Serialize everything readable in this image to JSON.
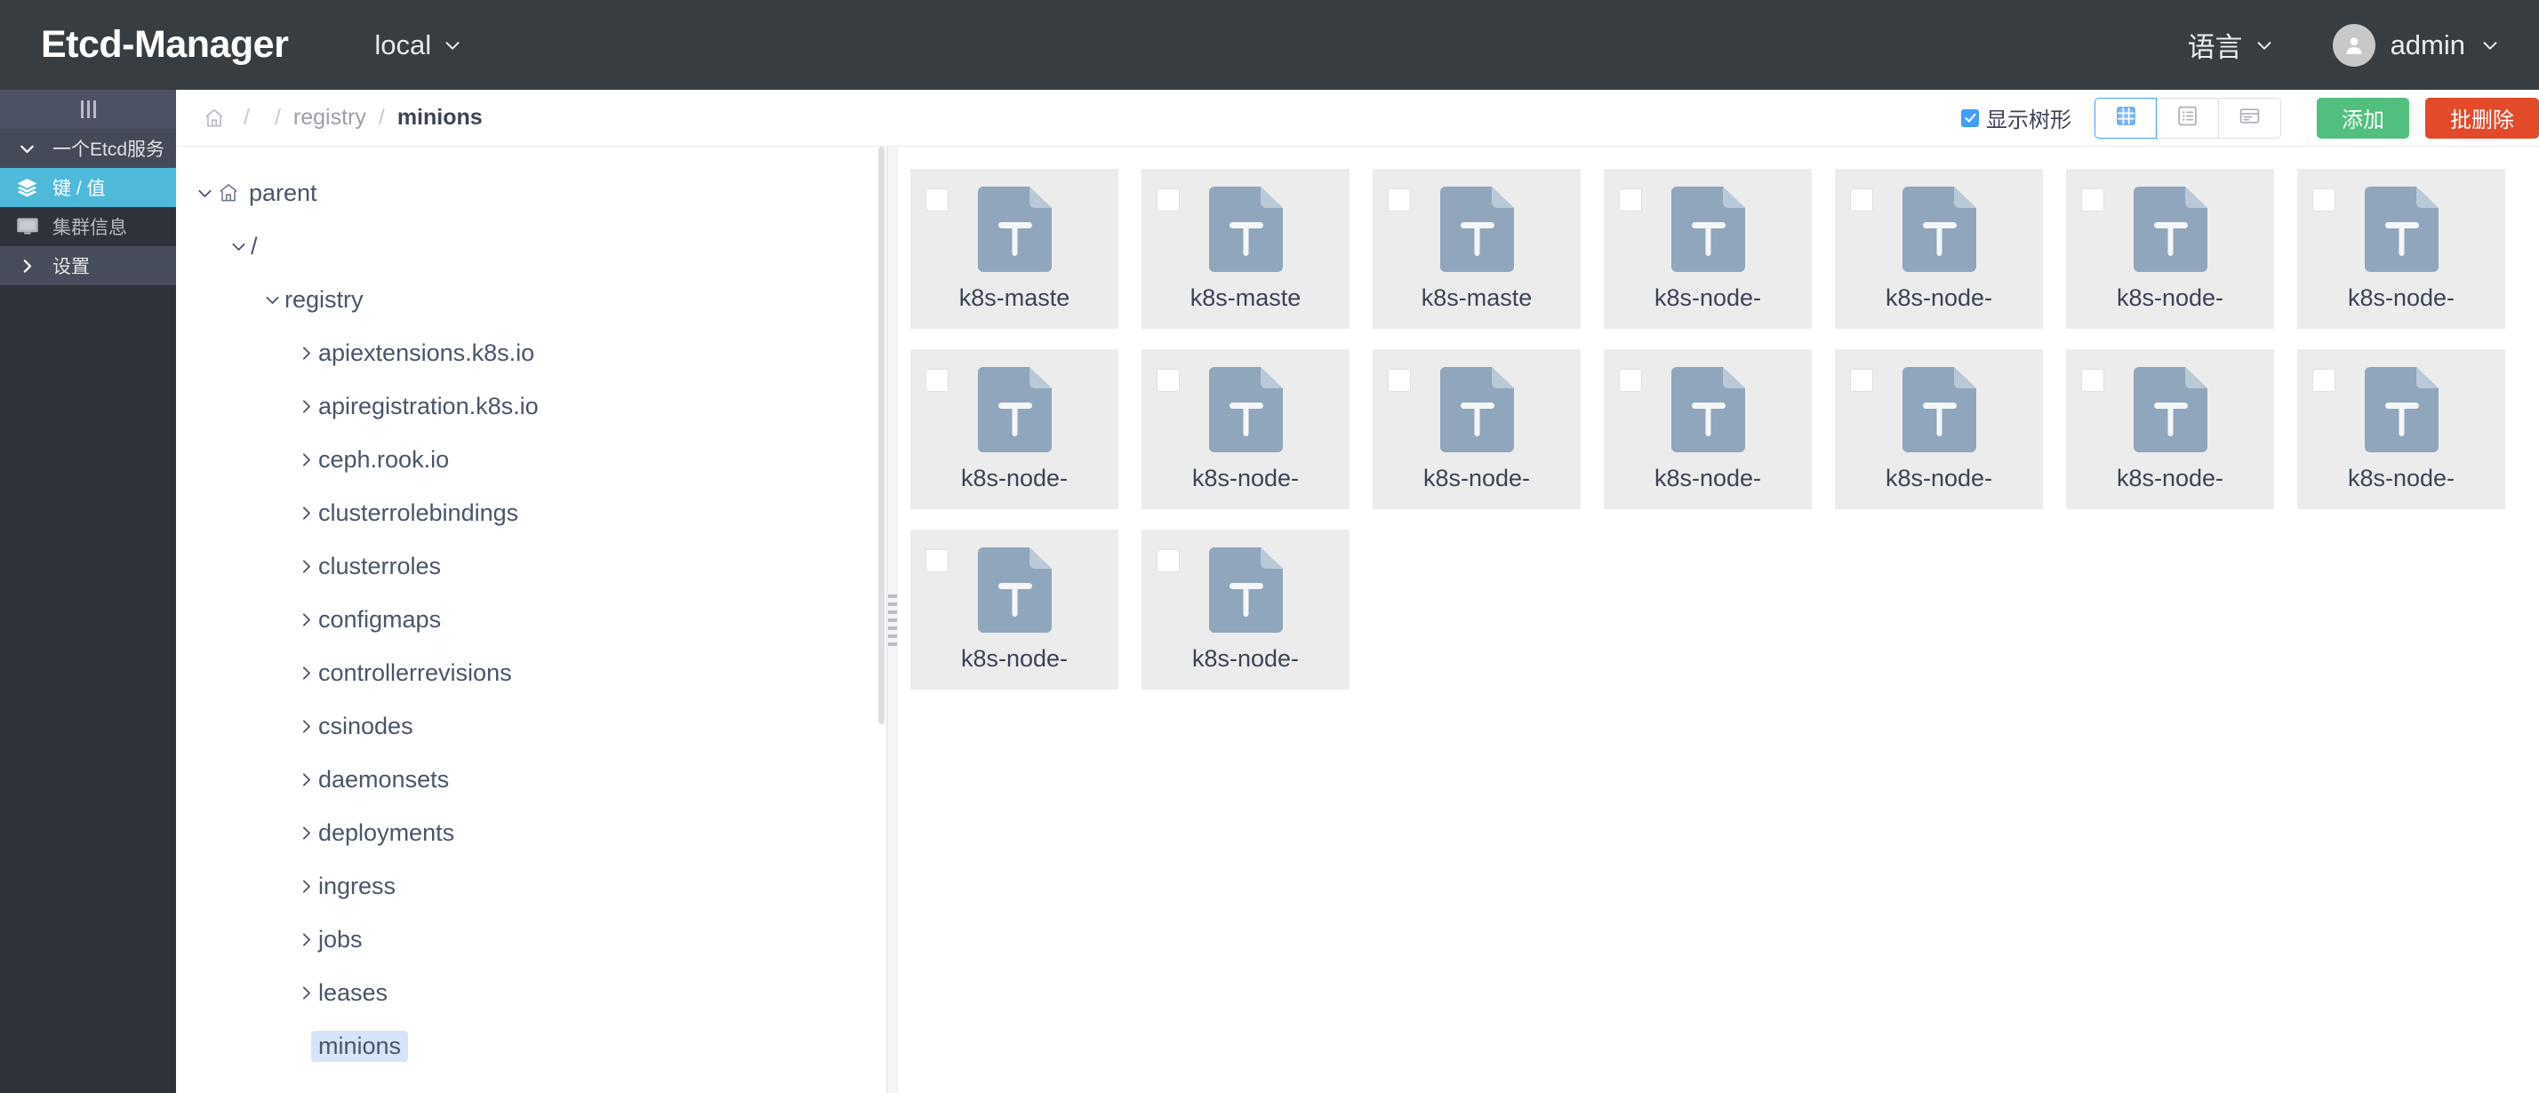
{
  "header": {
    "brand": "Etcd-Manager",
    "cluster_label": "local",
    "lang_label": "语言",
    "user_label": "admin",
    "avatar_icon": "user-icon",
    "chevron_icon": "chevron-down-icon"
  },
  "sidebar": {
    "collapse_icon": "collapse-bars-icon",
    "items": [
      {
        "label": "一个Etcd服务",
        "icon": "chevron-down-icon",
        "state": "group"
      },
      {
        "label": "键 / 值",
        "icon": "layers-icon",
        "state": "active"
      },
      {
        "label": "集群信息",
        "icon": "monitor-icon",
        "state": "plain"
      },
      {
        "label": "设置",
        "icon": "chevron-right-icon",
        "state": "settings"
      }
    ]
  },
  "toolbar": {
    "breadcrumb": {
      "home_icon": "home-icon",
      "separator": "/",
      "items": [
        {
          "label": "",
          "current": false
        },
        {
          "label": "registry",
          "current": false
        },
        {
          "label": "minions",
          "current": true
        }
      ]
    },
    "show_tree": {
      "label": "显示树形",
      "checked": true,
      "icon": "check-icon"
    },
    "view_modes": [
      {
        "icon": "grid-view-icon",
        "active": true
      },
      {
        "icon": "list-view-icon",
        "active": false
      },
      {
        "icon": "card-view-icon",
        "active": false
      }
    ],
    "add_label": "添加",
    "batch_delete_label": "批删除",
    "add_color": "#52bf7e",
    "delete_color": "#e24a2a"
  },
  "tree": {
    "nodes": [
      {
        "label": "parent",
        "indent": 0,
        "arrow": "chevron-down-icon",
        "icon": "home-icon",
        "selected": false
      },
      {
        "label": "/",
        "indent": 1,
        "arrow": "chevron-down-icon",
        "icon": "",
        "selected": false
      },
      {
        "label": "registry",
        "indent": 2,
        "arrow": "chevron-down-icon",
        "icon": "",
        "selected": false
      },
      {
        "label": "apiextensions.k8s.io",
        "indent": 3,
        "arrow": "chevron-right-icon",
        "icon": "",
        "selected": false
      },
      {
        "label": "apiregistration.k8s.io",
        "indent": 3,
        "arrow": "chevron-right-icon",
        "icon": "",
        "selected": false
      },
      {
        "label": "ceph.rook.io",
        "indent": 3,
        "arrow": "chevron-right-icon",
        "icon": "",
        "selected": false
      },
      {
        "label": "clusterrolebindings",
        "indent": 3,
        "arrow": "chevron-right-icon",
        "icon": "",
        "selected": false
      },
      {
        "label": "clusterroles",
        "indent": 3,
        "arrow": "chevron-right-icon",
        "icon": "",
        "selected": false
      },
      {
        "label": "configmaps",
        "indent": 3,
        "arrow": "chevron-right-icon",
        "icon": "",
        "selected": false
      },
      {
        "label": "controllerrevisions",
        "indent": 3,
        "arrow": "chevron-right-icon",
        "icon": "",
        "selected": false
      },
      {
        "label": "csinodes",
        "indent": 3,
        "arrow": "chevron-right-icon",
        "icon": "",
        "selected": false
      },
      {
        "label": "daemonsets",
        "indent": 3,
        "arrow": "chevron-right-icon",
        "icon": "",
        "selected": false
      },
      {
        "label": "deployments",
        "indent": 3,
        "arrow": "chevron-right-icon",
        "icon": "",
        "selected": false
      },
      {
        "label": "ingress",
        "indent": 3,
        "arrow": "chevron-right-icon",
        "icon": "",
        "selected": false
      },
      {
        "label": "jobs",
        "indent": 3,
        "arrow": "chevron-right-icon",
        "icon": "",
        "selected": false
      },
      {
        "label": "leases",
        "indent": 3,
        "arrow": "chevron-right-icon",
        "icon": "",
        "selected": false
      },
      {
        "label": "minions",
        "indent": 3,
        "arrow": "",
        "icon": "",
        "selected": true
      }
    ]
  },
  "content": {
    "file_icon": "text-file-icon",
    "file_icon_color": "#8fa6bc",
    "card_bg": "#ececec",
    "cards": [
      {
        "label": "k8s-maste",
        "checked": false
      },
      {
        "label": "k8s-maste",
        "checked": false
      },
      {
        "label": "k8s-maste",
        "checked": false
      },
      {
        "label": "k8s-node-",
        "checked": false
      },
      {
        "label": "k8s-node-",
        "checked": false
      },
      {
        "label": "k8s-node-",
        "checked": false
      },
      {
        "label": "k8s-node-",
        "checked": false
      },
      {
        "label": "k8s-node-",
        "checked": false
      },
      {
        "label": "k8s-node-",
        "checked": false
      },
      {
        "label": "k8s-node-",
        "checked": false
      },
      {
        "label": "k8s-node-",
        "checked": false
      },
      {
        "label": "k8s-node-",
        "checked": false
      },
      {
        "label": "k8s-node-",
        "checked": false
      },
      {
        "label": "k8s-node-",
        "checked": false
      },
      {
        "label": "k8s-node-",
        "checked": false
      },
      {
        "label": "k8s-node-",
        "checked": false
      }
    ]
  }
}
